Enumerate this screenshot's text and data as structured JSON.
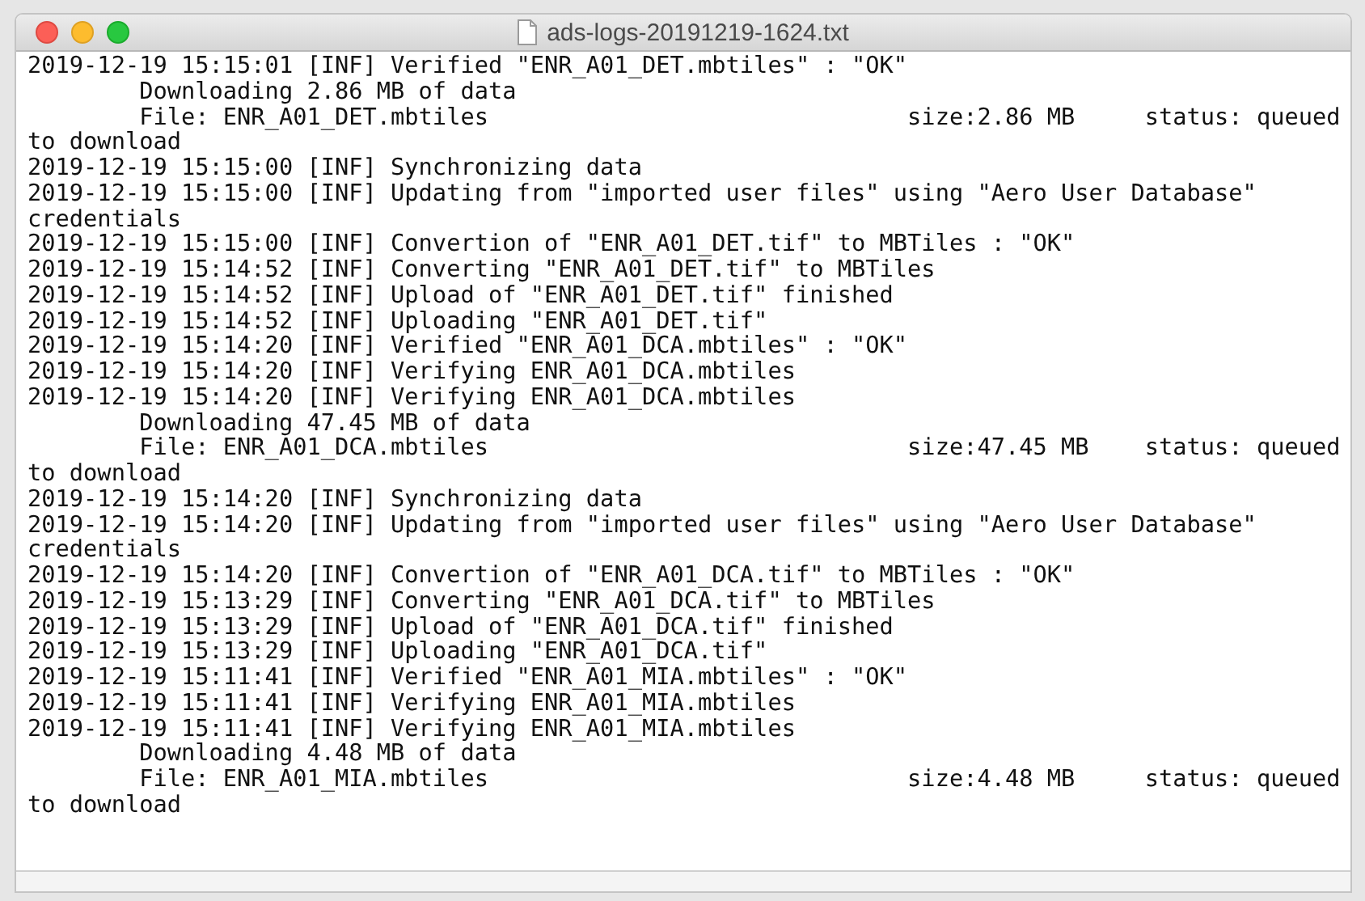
{
  "window": {
    "title": "ads-logs-20191219-1624.txt"
  },
  "lines": [
    "2019-12-19 15:15:01 [INF] Verified \"ENR_A01_DET.mbtiles\" : \"OK\"",
    "        Downloading 2.86 MB of data",
    "        File: ENR_A01_DET.mbtiles                              size:2.86 MB     status: queued",
    "to download",
    "2019-12-19 15:15:00 [INF] Synchronizing data",
    "2019-12-19 15:15:00 [INF] Updating from \"imported user files\" using \"Aero User Database\"",
    "credentials",
    "2019-12-19 15:15:00 [INF] Convertion of \"ENR_A01_DET.tif\" to MBTiles : \"OK\"",
    "2019-12-19 15:14:52 [INF] Converting \"ENR_A01_DET.tif\" to MBTiles",
    "2019-12-19 15:14:52 [INF] Upload of \"ENR_A01_DET.tif\" finished",
    "2019-12-19 15:14:52 [INF] Uploading \"ENR_A01_DET.tif\"",
    "2019-12-19 15:14:20 [INF] Verified \"ENR_A01_DCA.mbtiles\" : \"OK\"",
    "2019-12-19 15:14:20 [INF] Verifying ENR_A01_DCA.mbtiles",
    "2019-12-19 15:14:20 [INF] Verifying ENR_A01_DCA.mbtiles",
    "        Downloading 47.45 MB of data",
    "        File: ENR_A01_DCA.mbtiles                              size:47.45 MB    status: queued",
    "to download",
    "2019-12-19 15:14:20 [INF] Synchronizing data",
    "2019-12-19 15:14:20 [INF] Updating from \"imported user files\" using \"Aero User Database\"",
    "credentials",
    "2019-12-19 15:14:20 [INF] Convertion of \"ENR_A01_DCA.tif\" to MBTiles : \"OK\"",
    "2019-12-19 15:13:29 [INF] Converting \"ENR_A01_DCA.tif\" to MBTiles",
    "2019-12-19 15:13:29 [INF] Upload of \"ENR_A01_DCA.tif\" finished",
    "2019-12-19 15:13:29 [INF] Uploading \"ENR_A01_DCA.tif\"",
    "2019-12-19 15:11:41 [INF] Verified \"ENR_A01_MIA.mbtiles\" : \"OK\"",
    "2019-12-19 15:11:41 [INF] Verifying ENR_A01_MIA.mbtiles",
    "2019-12-19 15:11:41 [INF] Verifying ENR_A01_MIA.mbtiles",
    "        Downloading 4.48 MB of data",
    "        File: ENR_A01_MIA.mbtiles                              size:4.48 MB     status: queued",
    "to download"
  ]
}
